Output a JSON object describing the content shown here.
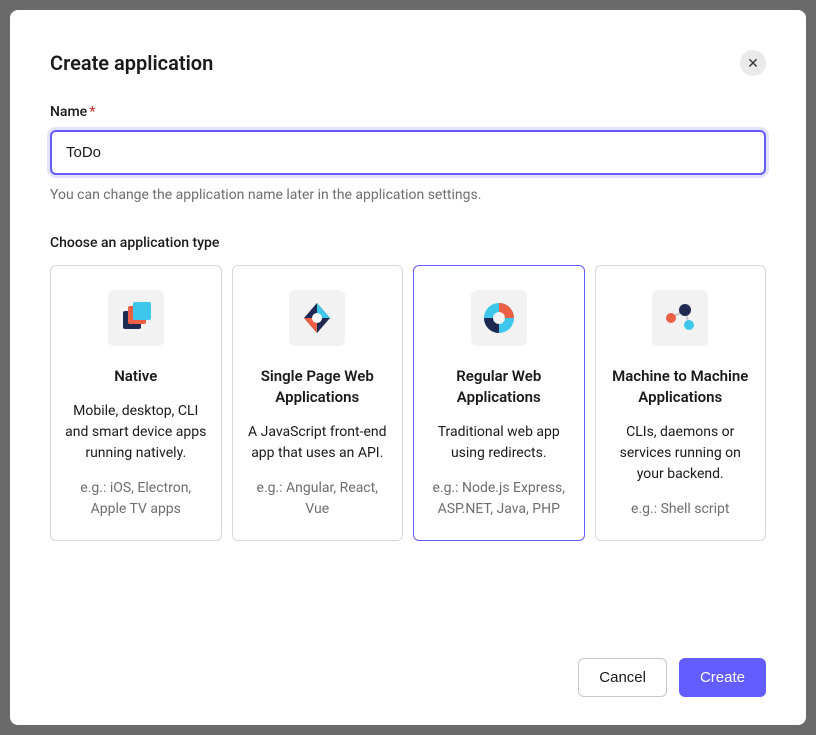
{
  "modal": {
    "title": "Create application",
    "name_label": "Name",
    "name_value": "ToDo",
    "name_hint": "You can change the application name later in the application settings.",
    "type_label": "Choose an application type",
    "cancel_label": "Cancel",
    "create_label": "Create"
  },
  "app_types": [
    {
      "title": "Native",
      "description": "Mobile, desktop, CLI and smart device apps running natively.",
      "example": "e.g.: iOS, Electron, Apple TV apps",
      "selected": false
    },
    {
      "title": "Single Page Web Applications",
      "description": "A JavaScript front-end app that uses an API.",
      "example": "e.g.: Angular, React, Vue",
      "selected": false
    },
    {
      "title": "Regular Web Applications",
      "description": "Traditional web app using redirects.",
      "example": "e.g.: Node.js Express, ASP.NET, Java, PHP",
      "selected": true
    },
    {
      "title": "Machine to Machine Applications",
      "description": "CLIs, daemons or services running on your backend.",
      "example": "e.g.: Shell script",
      "selected": false
    }
  ]
}
